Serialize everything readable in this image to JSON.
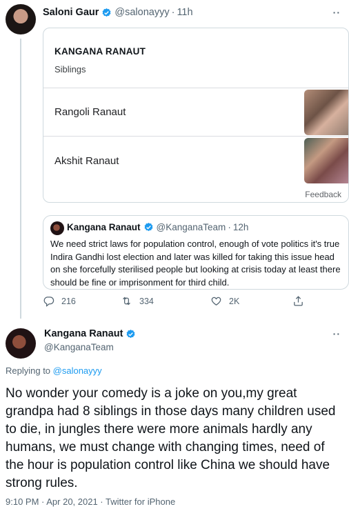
{
  "tweet1": {
    "author_name": "Saloni Gaur",
    "author_handle": "@salonayyy",
    "separator": "·",
    "time": "11h",
    "more": "··",
    "card": {
      "title": "KANGANA RANAUT",
      "subtitle": "Siblings",
      "items": [
        {
          "label": "Rangoli Ranaut"
        },
        {
          "label": "Akshit Ranaut"
        }
      ],
      "feedback": "Feedback"
    },
    "quote": {
      "author_name": "Kangana Ranaut",
      "author_handle": "@KanganaTeam",
      "separator": "·",
      "time": "12h",
      "text": "We need strict laws for population control, enough of vote politics it's true Indira Gandhi lost election and later was killed for taking this issue head on she forcefully sterilised people but looking at crisis today at least there should be fine or imprisonment for third child."
    },
    "actions": {
      "replies": "216",
      "retweets": "334",
      "likes": "2K"
    }
  },
  "tweet2": {
    "author_name": "Kangana Ranaut",
    "author_handle": "@KanganaTeam",
    "more": "··",
    "replying_prefix": "Replying to ",
    "replying_handle": "@salonayyy",
    "text": "No wonder your comedy is a joke on you,my great grandpa had 8 siblings in those days many children used to die, in jungles there were more animals hardly any humans, we must change with changing times, need of the hour is population control like China we should have strong rules.",
    "meta": "9:10 PM · Apr 20, 2021 · Twitter for iPhone"
  },
  "colors": {
    "verified": "#1d9bf0",
    "link": "#1d9bf0",
    "muted": "#536471",
    "border": "#cfd9de"
  },
  "icons": [
    "verified-badge-icon",
    "reply-icon",
    "retweet-icon",
    "like-icon",
    "share-icon",
    "more-icon"
  ]
}
